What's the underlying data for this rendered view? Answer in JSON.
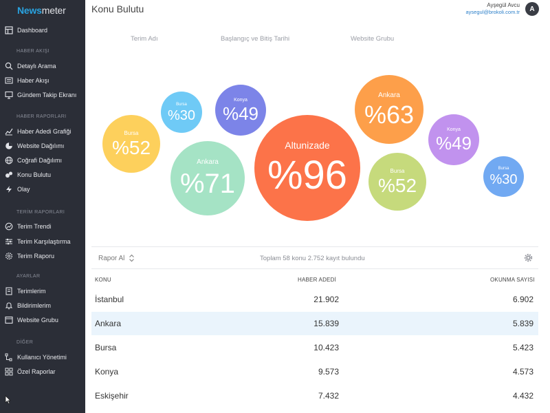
{
  "logo": {
    "part1": "News",
    "part2": "meter"
  },
  "sidebar": {
    "dashboard": "Dashboard",
    "sections": [
      {
        "heading": "HABER AKIŞI",
        "items": [
          "Detaylı Arama",
          "Haber Akışı",
          "Gündem Takip Ekranı"
        ]
      },
      {
        "heading": "HABER RAPORLARI",
        "items": [
          "Haber Adedi Grafiği",
          "Website Dağılımı",
          "Coğrafi Dağılımı",
          "Konu Bulutu",
          "Olay"
        ]
      },
      {
        "heading": "TERİM RAPORLARI",
        "items": [
          "Terim Trendi",
          "Terim Karşılaştırma",
          "Terim Raporu"
        ]
      },
      {
        "heading": "AYARLAR",
        "items": [
          "Terimlerim",
          "Bildirimlerim",
          "Website Grubu"
        ]
      },
      {
        "heading": "DİĞER",
        "items": [
          "Kullanıcı Yönetimi",
          "Özel Raporlar"
        ]
      }
    ]
  },
  "header": {
    "title": "Konu Bulutu",
    "user_name": "Ayşegül Avcu",
    "user_email": "aysegul@brokoli.com.tr",
    "avatar_letter": "A"
  },
  "filters": [
    "Terim Adı",
    "Başlangıç ve Bitiş Tarihi",
    "Website Grubu"
  ],
  "bubbles": [
    {
      "label": "Bursa",
      "pct": "%52",
      "color": "#fdd05c"
    },
    {
      "label": "Bursa",
      "pct": "%30",
      "color": "#6fcaf6"
    },
    {
      "label": "Konya",
      "pct": "%49",
      "color": "#7c84e8"
    },
    {
      "label": "Ankara",
      "pct": "%71",
      "color": "#a5e3c5"
    },
    {
      "label": "Altunizade",
      "pct": "%96",
      "color": "#fc7349"
    },
    {
      "label": "Ankara",
      "pct": "%63",
      "color": "#fd9f4a"
    },
    {
      "label": "Bursa",
      "pct": "%52",
      "color": "#c6da7c"
    },
    {
      "label": "Konya",
      "pct": "%49",
      "color": "#c192ee"
    },
    {
      "label": "Bursa",
      "pct": "%30",
      "color": "#71a9f2"
    }
  ],
  "toolbar": {
    "export_label": "Rapor Al",
    "summary": "Toplam 58 konu 2.752 kayıt bulundu"
  },
  "table": {
    "headers": [
      "KONU",
      "HABER ADEDİ",
      "OKUNMA SAYISI"
    ],
    "rows": [
      [
        "İstanbul",
        "21.902",
        "6.902"
      ],
      [
        "Ankara",
        "15.839",
        "5.839"
      ],
      [
        "Bursa",
        "10.423",
        "5.423"
      ],
      [
        "Konya",
        "9.573",
        "4.573"
      ],
      [
        "Eskişehir",
        "7.432",
        "4.432"
      ]
    ]
  }
}
